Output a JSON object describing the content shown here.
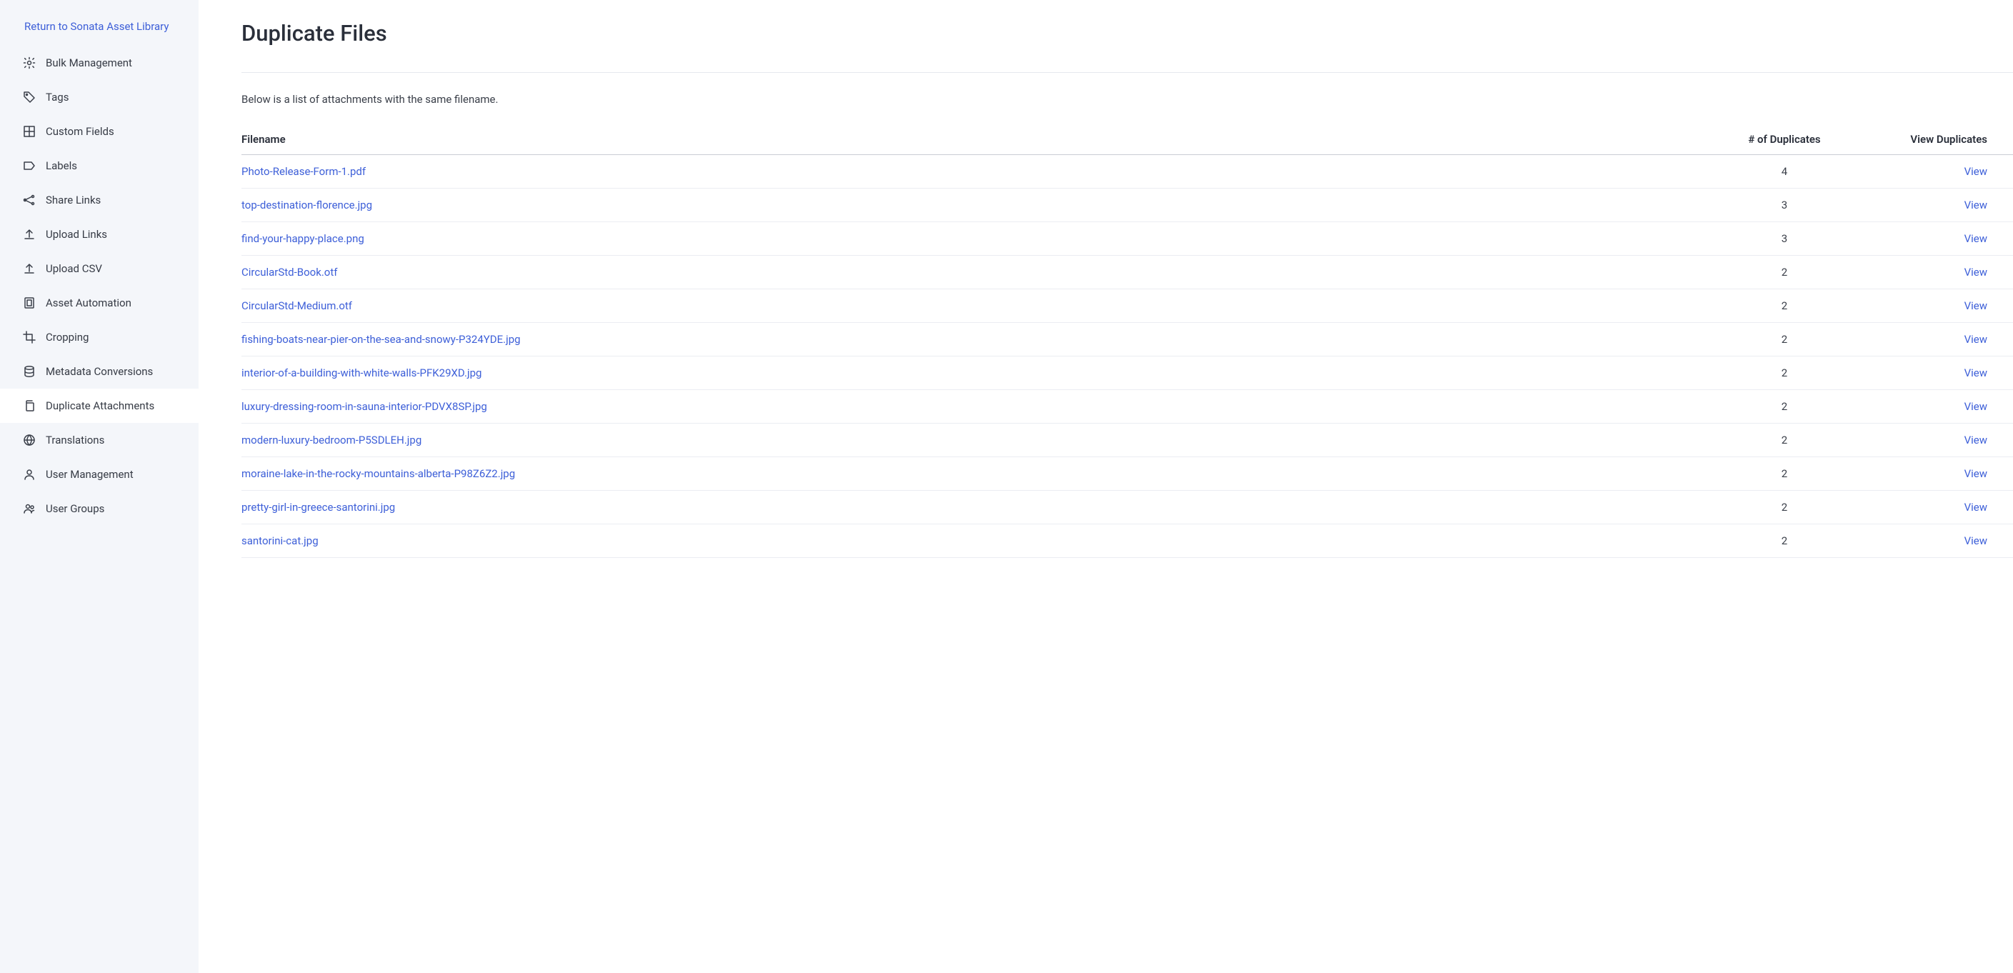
{
  "sidebar": {
    "return_label": "Return to Sonata Asset Library",
    "items": [
      {
        "label": "Bulk Management",
        "icon": "gear-icon",
        "active": false
      },
      {
        "label": "Tags",
        "icon": "tag-icon",
        "active": false
      },
      {
        "label": "Custom Fields",
        "icon": "grid-icon",
        "active": false
      },
      {
        "label": "Labels",
        "icon": "label-icon",
        "active": false
      },
      {
        "label": "Share Links",
        "icon": "share-icon",
        "active": false
      },
      {
        "label": "Upload Links",
        "icon": "upload-icon",
        "active": false
      },
      {
        "label": "Upload CSV",
        "icon": "upload-icon",
        "active": false
      },
      {
        "label": "Asset Automation",
        "icon": "automation-icon",
        "active": false
      },
      {
        "label": "Cropping",
        "icon": "crop-icon",
        "active": false
      },
      {
        "label": "Metadata Conversions",
        "icon": "database-icon",
        "active": false
      },
      {
        "label": "Duplicate Attachments",
        "icon": "copy-icon",
        "active": true
      },
      {
        "label": "Translations",
        "icon": "globe-icon",
        "active": false
      },
      {
        "label": "User Management",
        "icon": "user-icon",
        "active": false
      },
      {
        "label": "User Groups",
        "icon": "users-icon",
        "active": false
      }
    ]
  },
  "main": {
    "title": "Duplicate Files",
    "description": "Below is a list of attachments with the same filename.",
    "columns": {
      "filename": "Filename",
      "count": "# of Duplicates",
      "view": "View Duplicates"
    },
    "view_label": "View",
    "rows": [
      {
        "filename": "Photo-Release-Form-1.pdf",
        "count": "4"
      },
      {
        "filename": "top-destination-florence.jpg",
        "count": "3"
      },
      {
        "filename": "find-your-happy-place.png",
        "count": "3"
      },
      {
        "filename": "CircularStd-Book.otf",
        "count": "2"
      },
      {
        "filename": "CircularStd-Medium.otf",
        "count": "2"
      },
      {
        "filename": "fishing-boats-near-pier-on-the-sea-and-snowy-P324YDE.jpg",
        "count": "2"
      },
      {
        "filename": "interior-of-a-building-with-white-walls-PFK29XD.jpg",
        "count": "2"
      },
      {
        "filename": "luxury-dressing-room-in-sauna-interior-PDVX8SP.jpg",
        "count": "2"
      },
      {
        "filename": "modern-luxury-bedroom-P5SDLEH.jpg",
        "count": "2"
      },
      {
        "filename": "moraine-lake-in-the-rocky-mountains-alberta-P98Z6Z2.jpg",
        "count": "2"
      },
      {
        "filename": "pretty-girl-in-greece-santorini.jpg",
        "count": "2"
      },
      {
        "filename": "santorini-cat.jpg",
        "count": "2"
      }
    ]
  }
}
